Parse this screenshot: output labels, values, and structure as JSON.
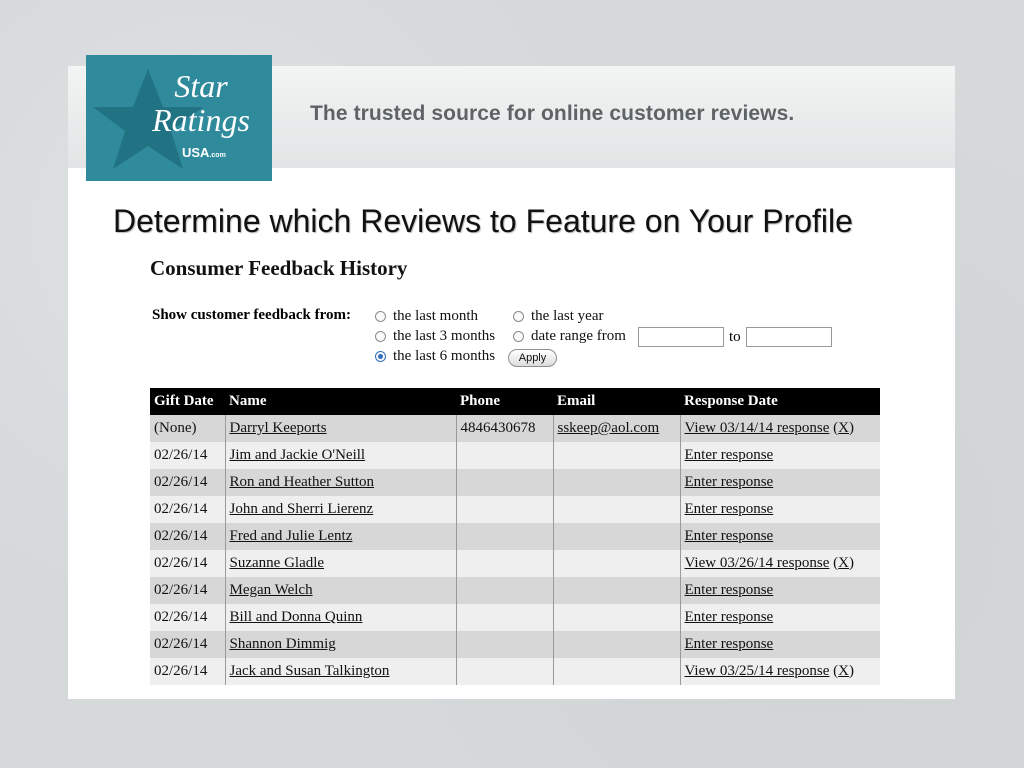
{
  "logo": {
    "line1": "Star",
    "line2": "Ratings",
    "usa": "USA",
    "usa_suffix": ".com",
    "color": "#2f8a9c"
  },
  "tagline": "The trusted source for online customer reviews.",
  "slide_title": "Determine which Reviews to Feature on Your Profile",
  "section_title": "Consumer Feedback History",
  "filter": {
    "label": "Show customer feedback from:",
    "options": [
      {
        "label": "the last month",
        "checked": false
      },
      {
        "label": "the last 3 months",
        "checked": false
      },
      {
        "label": "the last 6 months",
        "checked": true
      },
      {
        "label": "the last year",
        "checked": false
      },
      {
        "label": "date range from",
        "checked": false
      }
    ],
    "from_value": "",
    "to_label": "to",
    "to_value": "",
    "apply_label": "Apply"
  },
  "table": {
    "headers": [
      "Gift Date",
      "Name",
      "Phone",
      "Email",
      "Response Date"
    ],
    "rows": [
      {
        "date": "(None)",
        "name": "Darryl Keeports",
        "phone": "4846430678",
        "email": "sskeep@aol.com",
        "response": "View 03/14/14 response",
        "delete": "X"
      },
      {
        "date": "02/26/14",
        "name": "Jim and Jackie O'Neill",
        "phone": "",
        "email": "",
        "response": "Enter response",
        "delete": ""
      },
      {
        "date": "02/26/14",
        "name": "Ron and Heather Sutton",
        "phone": "",
        "email": "",
        "response": "Enter response",
        "delete": ""
      },
      {
        "date": "02/26/14",
        "name": "John and Sherri Lierenz",
        "phone": "",
        "email": "",
        "response": "Enter response",
        "delete": ""
      },
      {
        "date": "02/26/14",
        "name": "Fred and Julie Lentz",
        "phone": "",
        "email": "",
        "response": "Enter response",
        "delete": ""
      },
      {
        "date": "02/26/14",
        "name": "Suzanne Gladle",
        "phone": "",
        "email": "",
        "response": "View 03/26/14 response",
        "delete": "X"
      },
      {
        "date": "02/26/14",
        "name": "Megan Welch",
        "phone": "",
        "email": "",
        "response": "Enter response",
        "delete": ""
      },
      {
        "date": "02/26/14",
        "name": "Bill and Donna Quinn",
        "phone": "",
        "email": "",
        "response": "Enter response",
        "delete": ""
      },
      {
        "date": "02/26/14",
        "name": "Shannon Dimmig",
        "phone": "",
        "email": "",
        "response": "Enter response",
        "delete": ""
      },
      {
        "date": "02/26/14",
        "name": "Jack and Susan Talkington",
        "phone": "",
        "email": "",
        "response": "View 03/25/14 response",
        "delete": "X"
      }
    ]
  }
}
